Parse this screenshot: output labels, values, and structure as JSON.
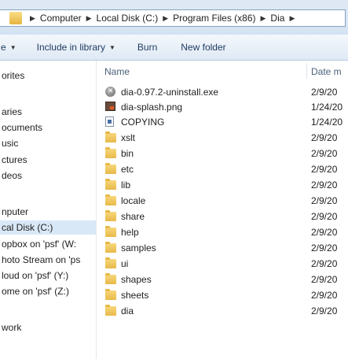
{
  "address": {
    "crumbs": [
      "Computer",
      "Local Disk (C:)",
      "Program Files (x86)",
      "Dia"
    ]
  },
  "toolbar": {
    "organize_fragment": "e",
    "include_library": "Include in library",
    "burn": "Burn",
    "new_folder": "New folder"
  },
  "nav": {
    "items": [
      {
        "label": "orites",
        "selected": false
      },
      {
        "label": "aries",
        "selected": false
      },
      {
        "label": "ocuments",
        "selected": false
      },
      {
        "label": "usic",
        "selected": false
      },
      {
        "label": "ctures",
        "selected": false
      },
      {
        "label": "deos",
        "selected": false
      },
      {
        "label": "nputer",
        "selected": false
      },
      {
        "label": "cal Disk (C:)",
        "selected": true
      },
      {
        "label": "opbox on 'psf' (W:",
        "selected": false
      },
      {
        "label": "hoto Stream on 'ps",
        "selected": false
      },
      {
        "label": "loud on 'psf' (Y:)",
        "selected": false
      },
      {
        "label": "ome on 'psf' (Z:)",
        "selected": false
      },
      {
        "label": "work",
        "selected": false
      }
    ]
  },
  "columns": {
    "name": "Name",
    "date": "Date m"
  },
  "files": [
    {
      "name": "dia-0.97.2-uninstall.exe",
      "date": "2/9/20",
      "icon": "uninstall-exe-icon"
    },
    {
      "name": "dia-splash.png",
      "date": "1/24/20",
      "icon": "png-image-icon"
    },
    {
      "name": "COPYING",
      "date": "1/24/20",
      "icon": "document-icon"
    },
    {
      "name": "xslt",
      "date": "2/9/20",
      "icon": "folder-icon"
    },
    {
      "name": "bin",
      "date": "2/9/20",
      "icon": "folder-icon"
    },
    {
      "name": "etc",
      "date": "2/9/20",
      "icon": "folder-icon"
    },
    {
      "name": "lib",
      "date": "2/9/20",
      "icon": "folder-icon"
    },
    {
      "name": "locale",
      "date": "2/9/20",
      "icon": "folder-icon"
    },
    {
      "name": "share",
      "date": "2/9/20",
      "icon": "folder-icon"
    },
    {
      "name": "help",
      "date": "2/9/20",
      "icon": "folder-icon"
    },
    {
      "name": "samples",
      "date": "2/9/20",
      "icon": "folder-icon"
    },
    {
      "name": "ui",
      "date": "2/9/20",
      "icon": "folder-icon"
    },
    {
      "name": "shapes",
      "date": "2/9/20",
      "icon": "folder-icon"
    },
    {
      "name": "sheets",
      "date": "2/9/20",
      "icon": "folder-icon"
    },
    {
      "name": "dia",
      "date": "2/9/20",
      "icon": "folder-icon"
    }
  ]
}
